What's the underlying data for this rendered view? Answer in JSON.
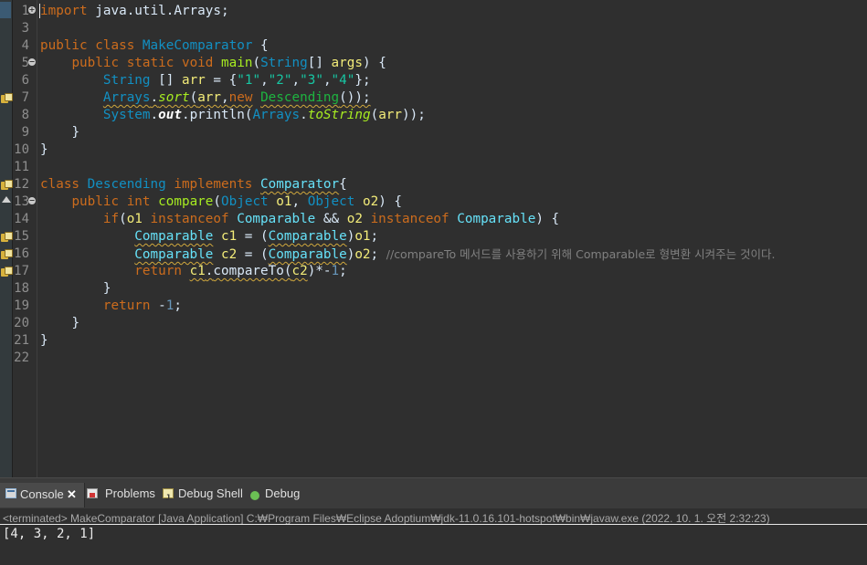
{
  "editor": {
    "line_numbers": [
      "1",
      "3",
      "4",
      "5",
      "6",
      "7",
      "8",
      "9",
      "10",
      "11",
      "12",
      "13",
      "14",
      "15",
      "16",
      "17",
      "18",
      "19",
      "20",
      "21",
      "22"
    ],
    "code": {
      "l1": {
        "kw_import": "import",
        "rest": " java.util.Arrays;"
      },
      "l4": {
        "kw_public": "public",
        "kw_class": "class",
        "name": "MakeComparator",
        "brace": " {"
      },
      "l5": {
        "kw_public": "public",
        "kw_static": "static",
        "kw_void": "void",
        "method": "main",
        "p1": "(",
        "type": "String",
        "p2": "[] ",
        "arg": "args",
        "p3": ") {"
      },
      "l6": {
        "type": "String",
        "p1": " [] ",
        "var": "arr",
        "p2": " = {",
        "s1": "\"1\"",
        "c1": ",",
        "s2": "\"2\"",
        "c2": ",",
        "s3": "\"3\"",
        "c3": ",",
        "s4": "\"4\"",
        "p3": "};"
      },
      "l7": {
        "cls": "Arrays",
        "dot": ".",
        "method": "sort",
        "p1": "(",
        "var": "arr",
        "comma": ",",
        "kw_new": "new",
        "ctor": "Descending",
        "p2": "());"
      },
      "l8": {
        "cls": "System",
        "dot": ".",
        "field": "out",
        "dot2": ".",
        "method": "println",
        "p1": "(",
        "cls2": "Arrays",
        "dot3": ".",
        "method2": "toString",
        "p2": "(",
        "var": "arr",
        "p3": "));"
      },
      "l9": {
        "brace": "}"
      },
      "l10": {
        "brace": "}"
      },
      "l12": {
        "kw_class": "class",
        "name": "Descending",
        "kw_impl": "implements",
        "iface": "Comparator",
        "brace": "{"
      },
      "l13": {
        "kw_public": "public",
        "kw_int": "int",
        "method": "compare",
        "p1": "(",
        "t1": "Object",
        "a1": "o1",
        "comma": ", ",
        "t2": "Object",
        "a2": "o2",
        "p2": ") {"
      },
      "l14": {
        "kw_if": "if",
        "p1": "(",
        "a1": "o1",
        "kw_inst1": "instanceof",
        "t1": "Comparable",
        "and": " && ",
        "a2": "o2",
        "kw_inst2": "instanceof",
        "t2": "Comparable",
        "p2": ") {"
      },
      "l15": {
        "type": "Comparable",
        "var": "c1",
        "eq": " = (",
        "cast": "Comparable",
        "p1": ")",
        "arg": "o1",
        "semi": ";"
      },
      "l16": {
        "type": "Comparable",
        "var": "c2",
        "eq": " = (",
        "cast": "Comparable",
        "p1": ")",
        "arg": "o2",
        "semi": ";",
        "comment": "//compareTo 메서드를 사용하기 위해 Comparable로 형변환 시켜주는 것이다."
      },
      "l17": {
        "kw_return": "return",
        "v1": "c1",
        "dot": ".",
        "method": "compareTo",
        "p1": "(",
        "v2": "c2",
        "p2": ")*-",
        "num": "1",
        "semi": ";"
      },
      "l18": {
        "brace": "}"
      },
      "l19": {
        "kw_return": "return",
        "minus": " -",
        "num": "1",
        "semi": ";"
      },
      "l20": {
        "brace": "}"
      },
      "l21": {
        "brace": "}"
      }
    }
  },
  "panel": {
    "tabs": {
      "console": "Console",
      "problems": "Problems",
      "debug_shell": "Debug Shell",
      "debug": "Debug"
    },
    "close_symbol": "✕",
    "terminated": "<terminated> MakeComparator [Java Application] C:₩Program Files₩Eclipse Adoptium₩jdk-11.0.16.101-hotspot₩bin₩javaw.exe  (2022. 10. 1. 오전 2:32:23)",
    "output": "[4, 3, 2, 1]"
  }
}
